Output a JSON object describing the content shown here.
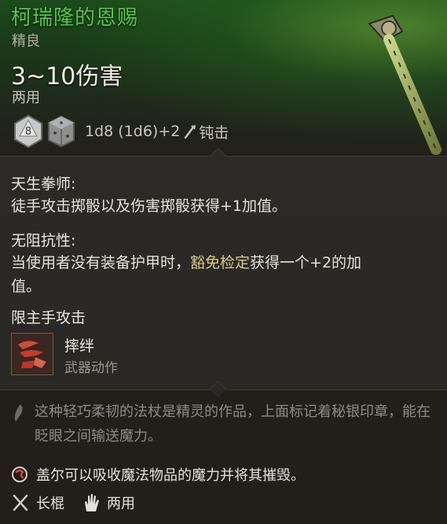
{
  "item": {
    "name": "柯瑞隆的恩赐",
    "rarity": "精良",
    "damage": "3~10伤害",
    "handedness": "两用",
    "dice": {
      "die1": "8",
      "formula": "1d8 (1d6)+2",
      "damage_type": "钝击"
    }
  },
  "passives": [
    {
      "title": "天生拳师:",
      "description": "徒手攻击掷骰以及伤害掷骰获得+1加值。"
    },
    {
      "title": "无阻抗性:",
      "description_before": "当使用者没有装备护甲时，",
      "description_highlight": "豁免检定",
      "description_after": "获得一个+2的加值。"
    }
  ],
  "mainhand_label": "限主手攻击",
  "action": {
    "name": "摔绊",
    "type": "武器动作"
  },
  "flavor": "这种轻巧柔韧的法杖是精灵的作品，上面标记着秘银印章，能在眨眼之间输送魔力。",
  "gale_note": "盖尔可以吸收魔法物品的魔力并将其摧毁。",
  "proficiency": {
    "weapon_type": "长棍",
    "hands": "两用"
  },
  "colors": {
    "title": "#55c84c",
    "highlight": "#d9c98a",
    "flavor": "#8f8a80"
  }
}
